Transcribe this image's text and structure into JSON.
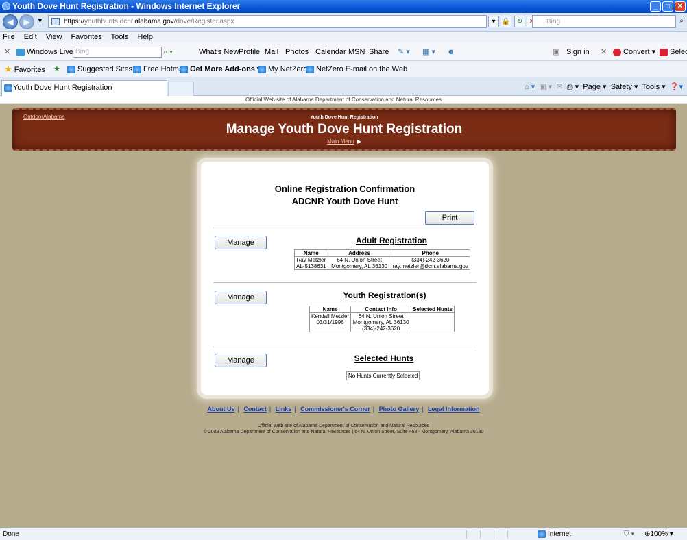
{
  "window": {
    "title": "Youth Dove Hunt Registration - Windows Internet Explorer"
  },
  "address": {
    "scheme": "https://",
    "pre": "youthhunts.dcnr.",
    "domain": "alabama.gov",
    "path": "/dove/Register.aspx"
  },
  "search_placeholder": "Bing",
  "menu": [
    "File",
    "Edit",
    "View",
    "Favorites",
    "Tools",
    "Help"
  ],
  "links_bar": {
    "windows_live": "Windows Live",
    "bing_box": "Bing",
    "items": [
      "What's New",
      "Profile",
      "Mail",
      "Photos",
      "Calendar",
      "MSN",
      "Share"
    ],
    "sign_in": "Sign in",
    "convert": "Convert",
    "select": "Select"
  },
  "favorites_bar": {
    "favorites": "Favorites",
    "items": [
      "Suggested Sites",
      "Free Hotmail",
      "Get More Add-ons",
      "My NetZero",
      "NetZero E-mail on the Web"
    ]
  },
  "tab": {
    "label": "Youth Dove Hunt Registration"
  },
  "commands": {
    "page": "Page",
    "safety": "Safety",
    "tools": "Tools"
  },
  "site": {
    "official_strip": "Official Web site of Alabama Department of Conservation and Natural Resources",
    "outdoor_link": "OutdoorAlabama",
    "banner_sub": "Youth Dove Hunt Registration",
    "banner_title": "Manage Youth Dove Hunt Registration",
    "main_menu": "Main Menu"
  },
  "confirm": {
    "title": "Online Registration Confirmation",
    "subtitle": "ADCNR Youth Dove Hunt",
    "print_label": "Print",
    "manage_label": "Manage",
    "adult": {
      "heading": "Adult Registration",
      "headers": [
        "Name",
        "Address",
        "Phone"
      ],
      "name": "Ray Metzler",
      "id": "AL-5138631",
      "addr1": "64 N. Union Street",
      "addr2": "Montgomery, AL 36130",
      "phone": "(334)-242-3620",
      "email": "ray.metzler@dcnr.alabama.gov"
    },
    "youth": {
      "heading": "Youth Registration(s)",
      "headers": [
        "Name",
        "Contact Info",
        "Selected Hunts"
      ],
      "name": "Kendall Metzler",
      "dob": "03/31/1996",
      "addr1": "64 N. Union Street",
      "addr2": "Montgomery, AL 36130",
      "phone": "(334)-242-3620"
    },
    "hunts": {
      "heading": "Selected Hunts",
      "empty": "No Hunts Currently Selected"
    }
  },
  "footer": {
    "links": [
      "About Us",
      "Contact",
      "Links",
      "Commissioner's Corner",
      "Photo Gallery",
      "Legal Information"
    ],
    "line1": "Official Web site of Alabama Department of Conservation and Natural Resources",
    "line2": "© 2008 Alabama Department of Conservation and Natural Resources  |  64 N. Union Street, Suite 468 - Montgomery, Alabama 36130"
  },
  "status": {
    "left": "Done",
    "zone": "Internet",
    "zoom": "100%"
  }
}
